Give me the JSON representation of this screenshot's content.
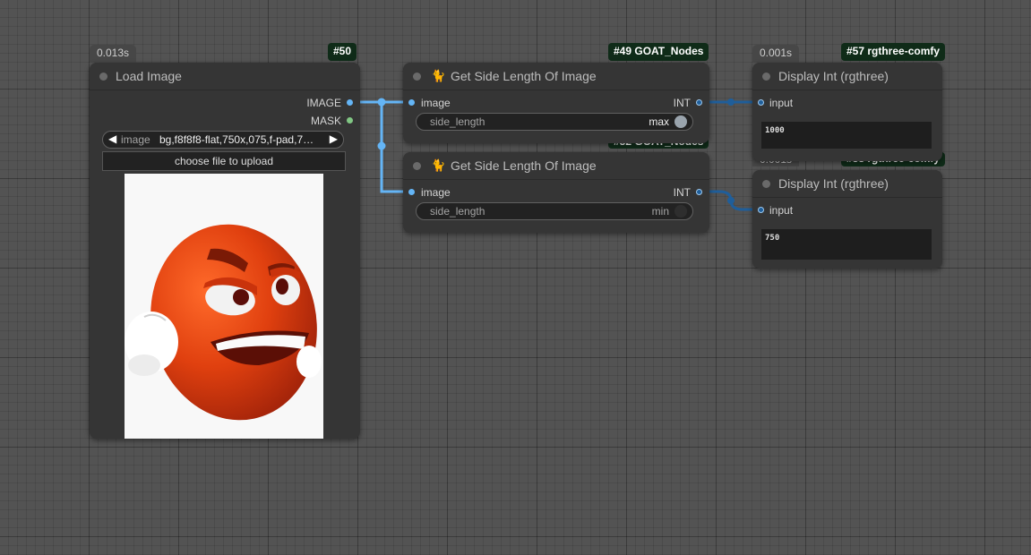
{
  "canvas": {
    "background": "#535353"
  },
  "nodes": {
    "load_image": {
      "time": "0.013s",
      "id": "#50",
      "title": "Load Image",
      "outputs": [
        {
          "label": "IMAGE",
          "color": "#64b5f6"
        },
        {
          "label": "MASK",
          "color": "#81c784"
        }
      ],
      "combo": {
        "name": "image",
        "value": "bg,f8f8f8-flat,750x,075,f-pad,7…",
        "prev_icon": "arrow-left",
        "next_icon": "arrow-right"
      },
      "upload_label": "choose file to upload",
      "preview": {
        "subject": "angry orange ball emoji with white gloved fists"
      }
    },
    "side_length_max": {
      "id": "#49 GOAT_Nodes",
      "icon": "cat-icon",
      "title": "Get Side Length Of Image",
      "input": "image",
      "output": "INT",
      "widget": {
        "name": "side_length",
        "value": "max"
      }
    },
    "side_length_min": {
      "id_partial": "#52 GOAT_Nodes",
      "icon": "cat-icon",
      "title": "Get Side Length Of Image",
      "input": "image",
      "output": "INT",
      "widget": {
        "name": "side_length",
        "value": "min"
      }
    },
    "display_int_1": {
      "time": "0.001s",
      "id": "#57 rgthree-comfy",
      "title": "Display Int (rgthree)",
      "input": "input",
      "value": "1000"
    },
    "display_int_2": {
      "time": "0.001s",
      "id": "#58 rgthree-comfy",
      "title": "Display Int (rgthree)",
      "input": "input",
      "value": "750"
    }
  },
  "colors": {
    "image_link": "#64b5f6",
    "int_link": "#1f5e9a",
    "badge_bg": "#0f2b18"
  }
}
